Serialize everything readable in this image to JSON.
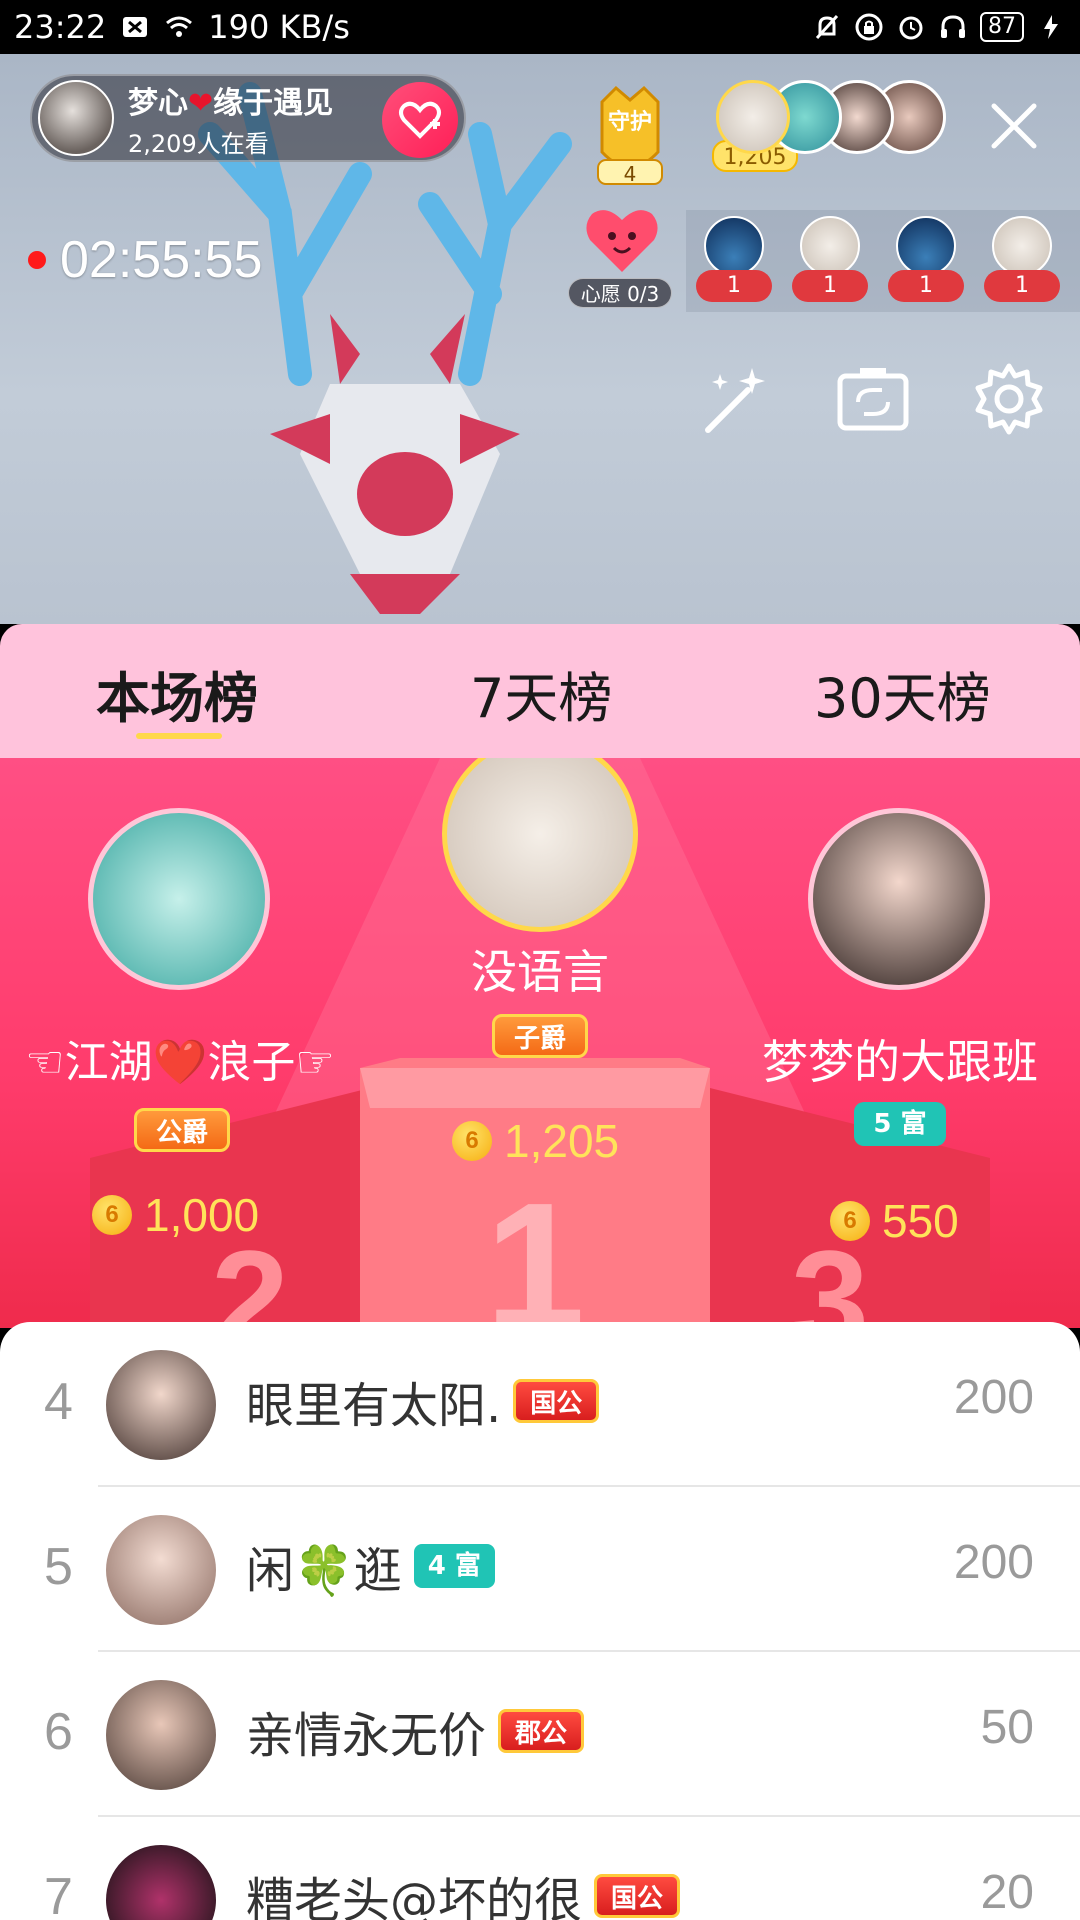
{
  "status_bar": {
    "time": "23:22",
    "speed": "190 KB/s",
    "battery": "87"
  },
  "host": {
    "name_pre": "梦心",
    "name_post": "缘于遇见",
    "viewers": "2,209人在看"
  },
  "guard": {
    "label": "守护",
    "count": "4"
  },
  "top_viewers_badge": "1,205",
  "timer": "02:55:55",
  "wish": {
    "label": "心愿 0/3"
  },
  "contributors": [
    "1",
    "1",
    "1",
    "1"
  ],
  "tools": [
    "magic-wand-icon",
    "camera-flip-icon",
    "settings-icon"
  ],
  "tabs": [
    {
      "label": "本场榜",
      "active": true
    },
    {
      "label": "7天榜",
      "active": false
    },
    {
      "label": "30天榜",
      "active": false
    }
  ],
  "podium": {
    "first": {
      "name": "没语言",
      "badge": "子爵",
      "coins": "1,205"
    },
    "second": {
      "name": "☜江湖❤️浪子☞",
      "badge": "公爵",
      "coins": "1,000"
    },
    "third": {
      "name": "梦梦的大跟班",
      "badge": "5 富",
      "coins": "550"
    },
    "coin_glyph": "6"
  },
  "list": [
    {
      "rank": "4",
      "name": "眼里有太阳.",
      "tag": "国公",
      "tag_style": "gold",
      "score": "200"
    },
    {
      "rank": "5",
      "name": "闲🍀逛",
      "tag": "4 富",
      "tag_style": "teal",
      "score": "200"
    },
    {
      "rank": "6",
      "name": "亲情永无价",
      "tag": "郡公",
      "tag_style": "gold",
      "score": "50"
    },
    {
      "rank": "7",
      "name": "糟老头@坏的很",
      "tag": "国公",
      "tag_style": "gold",
      "score": "20"
    }
  ],
  "colors": {
    "accent_pink": "#ff3c6c",
    "tab_bg": "#ffc3dc",
    "coin_yellow": "#ffe35a",
    "rank_gold_tag": "#e0393e",
    "rich_teal": "#20c4b5"
  }
}
